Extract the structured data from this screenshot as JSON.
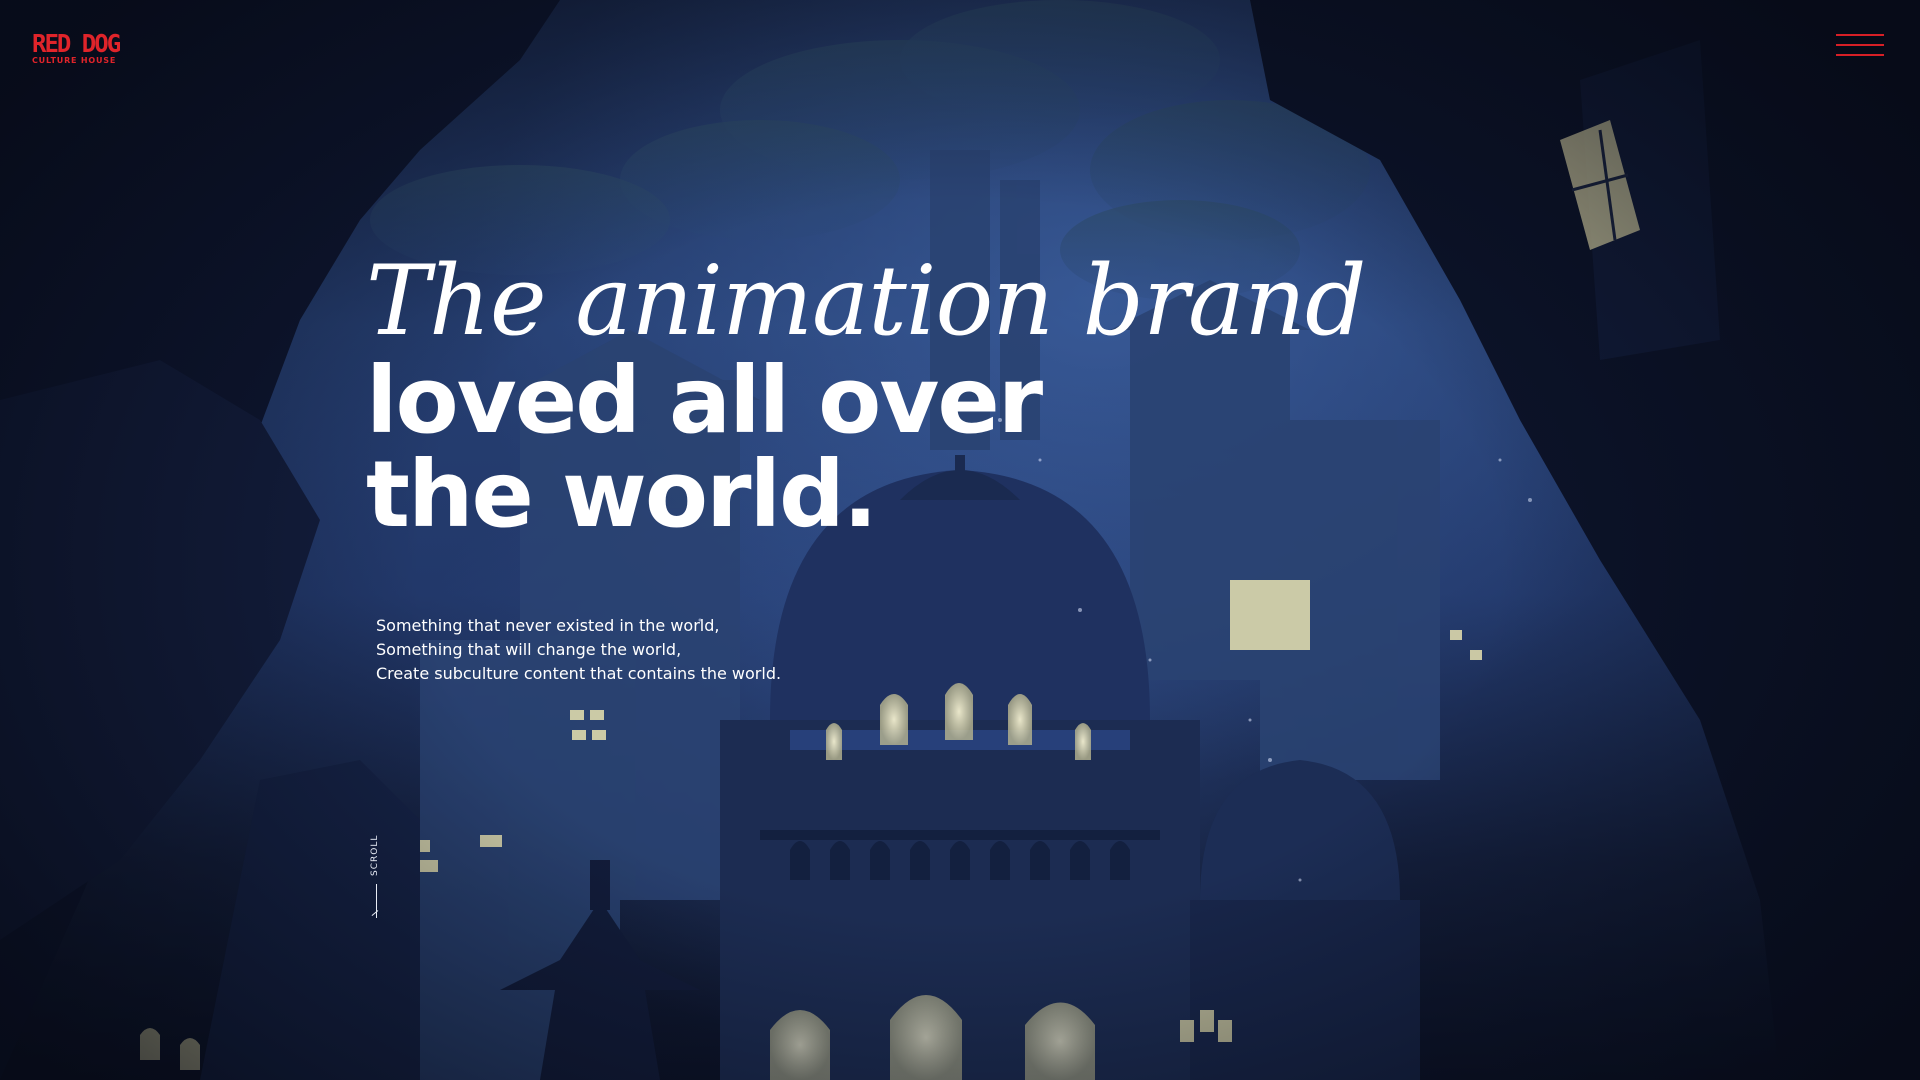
{
  "brand": {
    "name": "RED DOG",
    "sub": "CULTURE HOUSE"
  },
  "header": {
    "menu_icon": "hamburger-icon"
  },
  "hero": {
    "headline_italic": "The animation brand",
    "headline_bold_line1": "loved all over",
    "headline_bold_line2": "the world.",
    "tagline": [
      "Something that never existed in the world,",
      "Something that will change the world,",
      "Create subculture content that contains the world."
    ]
  },
  "scroll": {
    "label": "SCROLL",
    "icon": "arrow-down-icon"
  },
  "colors": {
    "accent": "#d71f26",
    "text": "#ffffff",
    "background": "#1f3466"
  }
}
